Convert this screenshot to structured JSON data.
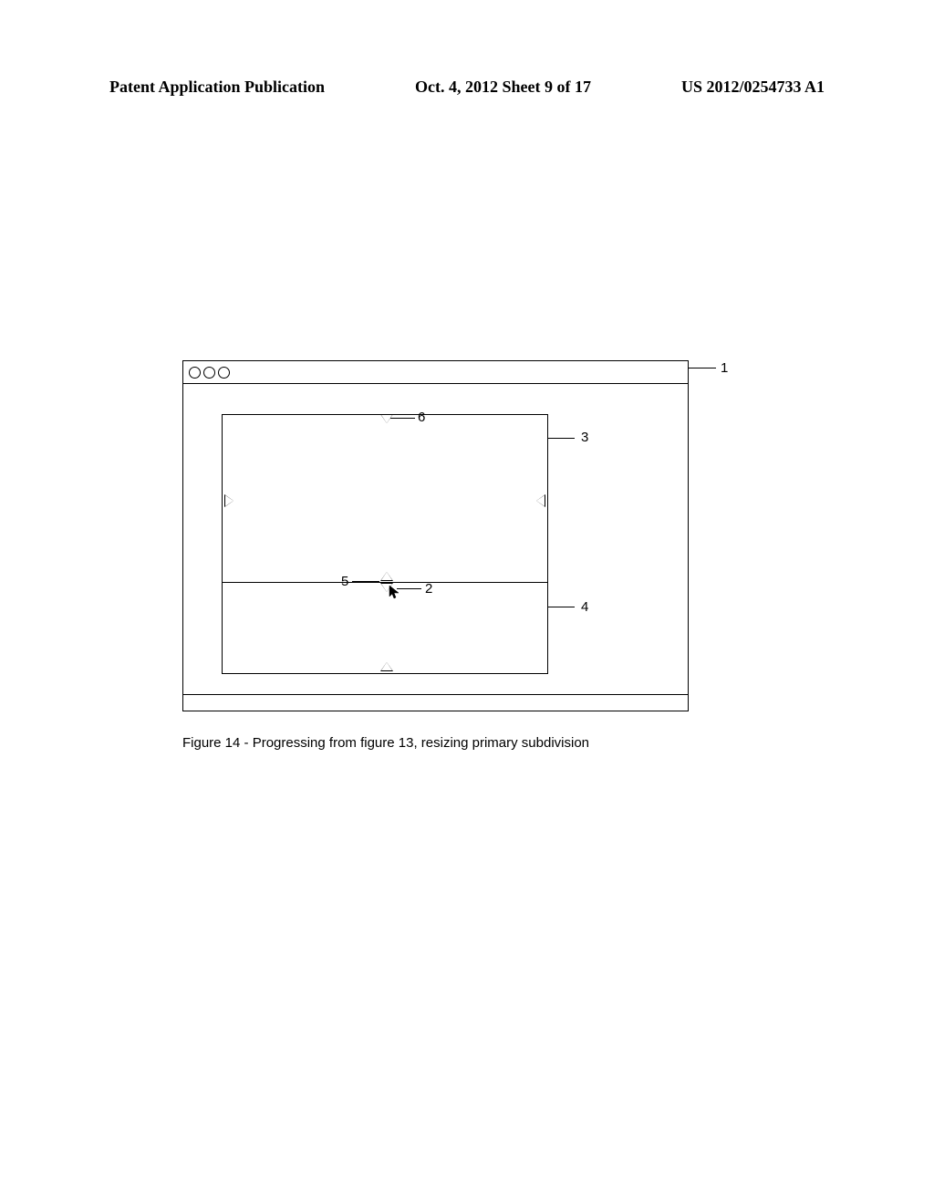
{
  "header": {
    "left": "Patent Application Publication",
    "center": "Oct. 4, 2012   Sheet 9 of 17",
    "right": "US 2012/0254733 A1"
  },
  "figure": {
    "refs": {
      "r1": "1",
      "r2": "2",
      "r3": "3",
      "r4": "4",
      "r5": "5",
      "r6": "6"
    }
  },
  "caption": "Figure 14 - Progressing from figure 13, resizing primary subdivision"
}
